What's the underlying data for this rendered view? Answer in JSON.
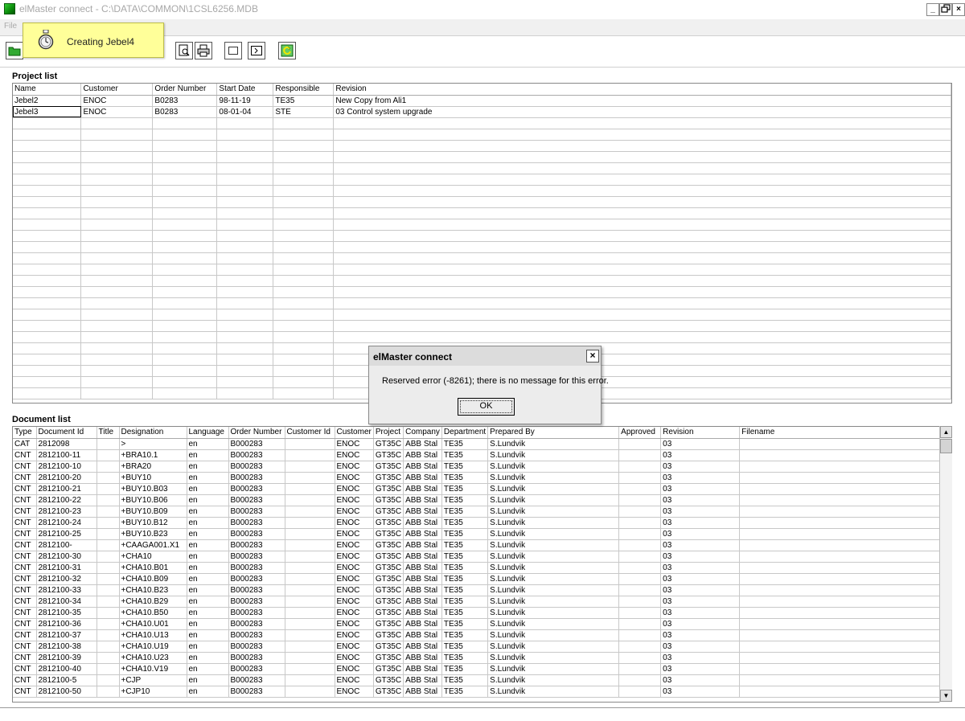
{
  "window": {
    "title": "elMaster connect - C:\\DATA\\COMMON\\1CSL6256.MDB",
    "minimize": "_",
    "restore": "̅̅",
    "close": "×"
  },
  "menu": {
    "file": "File"
  },
  "toast": {
    "text": "Creating Jebel4",
    "icon": "stopwatch-icon"
  },
  "toolbar": {
    "buttons": [
      "open-folder-icon",
      "print-preview-icon",
      "print-icon",
      "window-icon",
      "console-icon",
      "refresh-icon"
    ]
  },
  "project_list": {
    "label": "Project list",
    "headers": [
      "Name",
      "Customer",
      "Order Number",
      "Start Date",
      "Responsible",
      "Revision"
    ],
    "rows": [
      [
        "Jebel2",
        "ENOC",
        "B0283",
        "98-11-19",
        "TE35",
        "New Copy from Ali1"
      ],
      [
        "Jebel3",
        "ENOC",
        "B0283",
        "08-01-04",
        "STE",
        "03 Control system upgrade"
      ]
    ]
  },
  "document_list": {
    "label": "Document list",
    "headers": [
      "Type",
      "Document Id",
      "Title",
      "Designation",
      "Language",
      "Order Number",
      "Customer Id",
      "Customer",
      "Project",
      "Company",
      "Department",
      "Prepared By",
      "Approved",
      "Revision",
      "Filename"
    ],
    "rows": [
      [
        "CAT",
        "2812098",
        "",
        ">",
        "en",
        "B000283",
        "",
        "ENOC",
        "GT35C",
        "ABB Stal",
        "TE35",
        "S.Lundvik",
        "",
        "03",
        ""
      ],
      [
        "CNT",
        "2812100-11",
        "",
        "+BRA10.1",
        "en",
        "B000283",
        "",
        "ENOC",
        "GT35C",
        "ABB Stal",
        "TE35",
        "S.Lundvik",
        "",
        "03",
        ""
      ],
      [
        "CNT",
        "2812100-10",
        "",
        "+BRA20",
        "en",
        "B000283",
        "",
        "ENOC",
        "GT35C",
        "ABB Stal",
        "TE35",
        "S.Lundvik",
        "",
        "03",
        ""
      ],
      [
        "CNT",
        "2812100-20",
        "",
        "+BUY10",
        "en",
        "B000283",
        "",
        "ENOC",
        "GT35C",
        "ABB Stal",
        "TE35",
        "S.Lundvik",
        "",
        "03",
        ""
      ],
      [
        "CNT",
        "2812100-21",
        "",
        "+BUY10.B03",
        "en",
        "B000283",
        "",
        "ENOC",
        "GT35C",
        "ABB Stal",
        "TE35",
        "S.Lundvik",
        "",
        "03",
        ""
      ],
      [
        "CNT",
        "2812100-22",
        "",
        "+BUY10.B06",
        "en",
        "B000283",
        "",
        "ENOC",
        "GT35C",
        "ABB Stal",
        "TE35",
        "S.Lundvik",
        "",
        "03",
        ""
      ],
      [
        "CNT",
        "2812100-23",
        "",
        "+BUY10.B09",
        "en",
        "B000283",
        "",
        "ENOC",
        "GT35C",
        "ABB Stal",
        "TE35",
        "S.Lundvik",
        "",
        "03",
        ""
      ],
      [
        "CNT",
        "2812100-24",
        "",
        "+BUY10.B12",
        "en",
        "B000283",
        "",
        "ENOC",
        "GT35C",
        "ABB Stal",
        "TE35",
        "S.Lundvik",
        "",
        "03",
        ""
      ],
      [
        "CNT",
        "2812100-25",
        "",
        "+BUY10.B23",
        "en",
        "B000283",
        "",
        "ENOC",
        "GT35C",
        "ABB Stal",
        "TE35",
        "S.Lundvik",
        "",
        "03",
        ""
      ],
      [
        "CNT",
        "2812100-",
        "",
        "+CAAGA001.X1",
        "en",
        "B000283",
        "",
        "ENOC",
        "GT35C",
        "ABB Stal",
        "TE35",
        "S.Lundvik",
        "",
        "03",
        ""
      ],
      [
        "CNT",
        "2812100-30",
        "",
        "+CHA10",
        "en",
        "B000283",
        "",
        "ENOC",
        "GT35C",
        "ABB Stal",
        "TE35",
        "S.Lundvik",
        "",
        "03",
        ""
      ],
      [
        "CNT",
        "2812100-31",
        "",
        "+CHA10.B01",
        "en",
        "B000283",
        "",
        "ENOC",
        "GT35C",
        "ABB Stal",
        "TE35",
        "S.Lundvik",
        "",
        "03",
        ""
      ],
      [
        "CNT",
        "2812100-32",
        "",
        "+CHA10.B09",
        "en",
        "B000283",
        "",
        "ENOC",
        "GT35C",
        "ABB Stal",
        "TE35",
        "S.Lundvik",
        "",
        "03",
        ""
      ],
      [
        "CNT",
        "2812100-33",
        "",
        "+CHA10.B23",
        "en",
        "B000283",
        "",
        "ENOC",
        "GT35C",
        "ABB Stal",
        "TE35",
        "S.Lundvik",
        "",
        "03",
        ""
      ],
      [
        "CNT",
        "2812100-34",
        "",
        "+CHA10.B29",
        "en",
        "B000283",
        "",
        "ENOC",
        "GT35C",
        "ABB Stal",
        "TE35",
        "S.Lundvik",
        "",
        "03",
        ""
      ],
      [
        "CNT",
        "2812100-35",
        "",
        "+CHA10.B50",
        "en",
        "B000283",
        "",
        "ENOC",
        "GT35C",
        "ABB Stal",
        "TE35",
        "S.Lundvik",
        "",
        "03",
        ""
      ],
      [
        "CNT",
        "2812100-36",
        "",
        "+CHA10.U01",
        "en",
        "B000283",
        "",
        "ENOC",
        "GT35C",
        "ABB Stal",
        "TE35",
        "S.Lundvik",
        "",
        "03",
        ""
      ],
      [
        "CNT",
        "2812100-37",
        "",
        "+CHA10.U13",
        "en",
        "B000283",
        "",
        "ENOC",
        "GT35C",
        "ABB Stal",
        "TE35",
        "S.Lundvik",
        "",
        "03",
        ""
      ],
      [
        "CNT",
        "2812100-38",
        "",
        "+CHA10.U19",
        "en",
        "B000283",
        "",
        "ENOC",
        "GT35C",
        "ABB Stal",
        "TE35",
        "S.Lundvik",
        "",
        "03",
        ""
      ],
      [
        "CNT",
        "2812100-39",
        "",
        "+CHA10.U23",
        "en",
        "B000283",
        "",
        "ENOC",
        "GT35C",
        "ABB Stal",
        "TE35",
        "S.Lundvik",
        "",
        "03",
        ""
      ],
      [
        "CNT",
        "2812100-40",
        "",
        "+CHA10.V19",
        "en",
        "B000283",
        "",
        "ENOC",
        "GT35C",
        "ABB Stal",
        "TE35",
        "S.Lundvik",
        "",
        "03",
        ""
      ],
      [
        "CNT",
        "2812100-5",
        "",
        "+CJP",
        "en",
        "B000283",
        "",
        "ENOC",
        "GT35C",
        "ABB Stal",
        "TE35",
        "S.Lundvik",
        "",
        "03",
        ""
      ],
      [
        "CNT",
        "2812100-50",
        "",
        "+CJP10",
        "en",
        "B000283",
        "",
        "ENOC",
        "GT35C",
        "ABB Stal",
        "TE35",
        "S.Lundvik",
        "",
        "03",
        ""
      ]
    ]
  },
  "dialog": {
    "title": "elMaster connect",
    "message": "Reserved error (-8261); there is no message for this error.",
    "ok_label": "OK",
    "close": "×"
  },
  "scrollbar": {
    "up": "▲",
    "down": "▼"
  }
}
